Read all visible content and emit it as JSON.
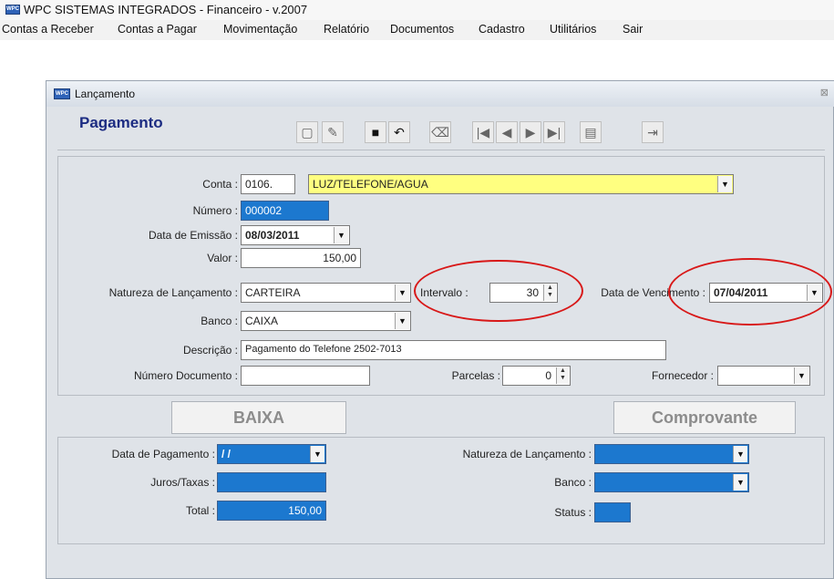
{
  "app": {
    "title": "WPC SISTEMAS INTEGRADOS - Financeiro - v.2007",
    "logo_text": "WPC"
  },
  "menu": [
    "Contas a Receber",
    "Contas a Pagar",
    "Movimentação",
    "Relatório",
    "Documentos",
    "Cadastro",
    "Utilitários",
    "Sair"
  ],
  "window": {
    "title": "Lançamento",
    "close_glyph": "⊠",
    "logo_text": "WPC"
  },
  "heading": "Pagamento",
  "toolbar": {
    "new": "▢",
    "edit": "✎",
    "save": "■",
    "undo": "↶",
    "delete": "⌫",
    "first": "|◀",
    "prev": "◀",
    "next": "▶",
    "last": "▶|",
    "print": "▤",
    "exit": "⇥"
  },
  "form": {
    "conta_label": "Conta :",
    "conta_code": "0106.",
    "conta_name": "LUZ/TELEFONE/AGUA",
    "numero_label": "Número :",
    "numero": "000002",
    "emissao_label": "Data de Emissão :",
    "emissao": "08/03/2011",
    "valor_label": "Valor :",
    "valor": "150,00",
    "natureza_label": "Natureza de Lançamento :",
    "natureza": "CARTEIRA",
    "intervalo_label": "Intervalo :",
    "intervalo": "30",
    "vencimento_label": "Data de Vencimento :",
    "vencimento": "07/04/2011",
    "banco_label": "Banco :",
    "banco": "CAIXA",
    "descricao_label": "Descrição :",
    "descricao": "Pagamento do Telefone 2502-7013",
    "numdoc_label": "Número Documento :",
    "numdoc": "",
    "parcelas_label": "Parcelas :",
    "parcelas": "0",
    "fornecedor_label": "Fornecedor :",
    "fornecedor": ""
  },
  "buttons": {
    "baixa": "BAIXA",
    "comprovante": "Comprovante"
  },
  "payment": {
    "data_pagamento_label": "Data de Pagamento :",
    "data_pagamento": " / /",
    "juros_label": "Juros/Taxas :",
    "juros": "",
    "total_label": "Total :",
    "total": "150,00",
    "natureza_label": "Natureza de Lançamento :",
    "natureza": "",
    "banco_label": "Banco :",
    "banco": "",
    "status_label": "Status :",
    "status": ""
  },
  "glyphs": {
    "dropdown": "▼",
    "spin_up": "▲",
    "spin_down": "▼"
  },
  "colors": {
    "highlight_field": "#ffff80",
    "selected_field": "#1c78cf",
    "annotation": "#d81818"
  }
}
